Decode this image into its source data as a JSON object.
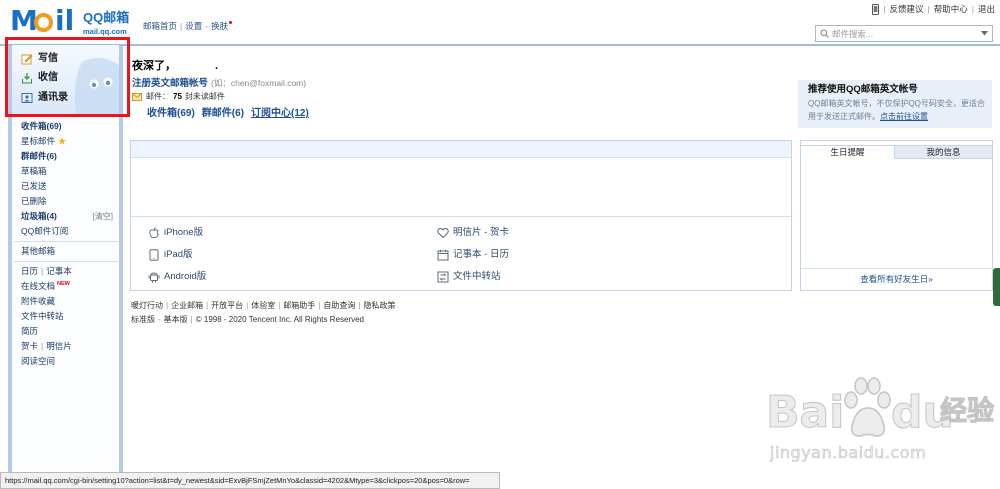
{
  "logo": {
    "mark_left": "M",
    "mark_right": "il",
    "name": "QQ邮箱",
    "domain": "mail.qq.com"
  },
  "seps": {
    "bar": "|",
    "dash": "-"
  },
  "topnav": {
    "home": "邮箱首页",
    "settings": "设置",
    "skin": "换肤"
  },
  "toplinks": {
    "feedback": "反馈建议",
    "help": "帮助中心",
    "logout": "退出"
  },
  "search": {
    "placeholder": "邮件搜索..."
  },
  "sidebar": {
    "compose": "写信",
    "receive": "收信",
    "contacts": "通讯录",
    "folders": {
      "inbox": "收件箱(69)",
      "starred": "星标邮件",
      "group": "群邮件(6)",
      "drafts": "草稿箱",
      "sent": "已发送",
      "deleted": "已删除",
      "spam": "垃圾箱(4)",
      "spam_clear": "[清空]",
      "subscriptions": "QQ邮件订阅"
    },
    "other_mailbox": "其他邮箱",
    "tools": {
      "calendar": "日历",
      "notepad": "记事本",
      "docs": "在线文档",
      "docs_badge": "NEW",
      "attachments": "附件收藏",
      "file_transfer": "文件中转站",
      "resume": "简历",
      "cards": "贺卡",
      "postcards": "明信片",
      "reading": "阅读空间"
    }
  },
  "main": {
    "greeting": "夜深了，",
    "greeting_suffix": ".",
    "register_link": "注册英文邮箱帐号",
    "register_hint": "(如：chen@foxmail.com)",
    "unread": {
      "label": "邮件：",
      "count": "75",
      "suffix": "封未读邮件"
    },
    "quicklinks": [
      "收件箱(69)",
      "群邮件(6)",
      "订阅中心(12)"
    ],
    "apps": {
      "iphone": "iPhone版",
      "ipad": "iPad版",
      "android": "Android版",
      "cards": "明信片 - 贺卡",
      "notes": "记事本 - 日历",
      "transfer": "文件中转站"
    }
  },
  "promo": {
    "title": "推荐使用QQ邮箱英文帐号",
    "body": "QQ邮箱英文帐号，不仅保护QQ号码安全，更适合用于发送正式邮件。",
    "link": "点击前往设置"
  },
  "side_panel": {
    "tabs": [
      "生日提醒",
      "我的信息"
    ],
    "footer_link": "查看所有好友生日»"
  },
  "footer": {
    "links": [
      "暖灯行动",
      "企业邮箱",
      "开放平台",
      "体验室",
      "邮箱助手",
      "自助查询",
      "隐私政策"
    ],
    "versions": [
      "标准版",
      "基本版"
    ],
    "copyright": "© 1998 - 2020 Tencent Inc. All Rights Reserved"
  },
  "status_bar": {
    "url": "https://mail.qq.com/cgi-bin/setting10?action=list&t=dy_newest&sid=ExvBjFSmjZetMnYo&classid=4202&Mtype=3&clickpos=20&pos=0&row="
  },
  "watermark": {
    "brand_left": "Bai",
    "brand_right": "du",
    "brand_cn": "经验",
    "url": "jingyan.baidu.com"
  },
  "colors": {
    "link": "#1e4f93",
    "highlight": "#e8151d",
    "accent": "#1b6fc2",
    "logo_orange": "#f29b1e",
    "panel_border": "#c3d4e9",
    "badge": "#e60012"
  },
  "icons": [
    "phone-icon",
    "search-icon",
    "chevron-down-icon",
    "pencil-icon",
    "inbox-arrow-icon",
    "contacts-icon",
    "star-icon",
    "envelope-icon",
    "apple-icon",
    "tablet-icon",
    "android-icon",
    "heart-icon",
    "calendar-icon",
    "file-transfer-icon",
    "paw-icon"
  ]
}
